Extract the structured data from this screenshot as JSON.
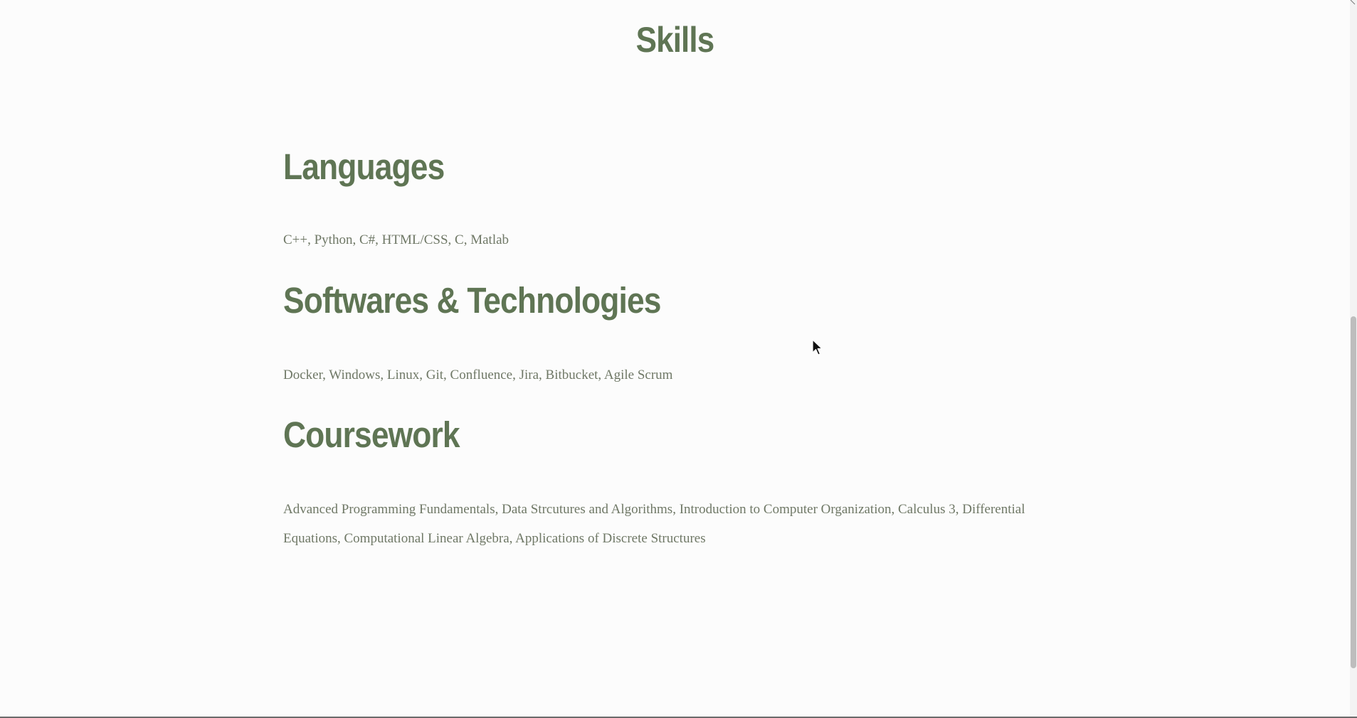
{
  "page": {
    "title": "Skills"
  },
  "sections": [
    {
      "heading": "Languages",
      "text": "C++, Python, C#, HTML/CSS, C, Matlab"
    },
    {
      "heading": "Softwares & Technologies",
      "text": "Docker, Windows, Linux, Git, Confluence, Jira, Bitbucket, Agile Scrum"
    },
    {
      "heading": "Coursework",
      "text": "Advanced Programming Fundamentals, Data Strcutures and Algorithms, Introduction to Computer Organization, Calculus 3, Differential Equations, Computational Linear Algebra, Applications of Discrete Structures"
    }
  ],
  "colors": {
    "heading": "#5f7554",
    "body_text": "#6f7866",
    "background": "#fcfcfc"
  },
  "icons": {
    "cursor": "mouse-pointer-icon"
  }
}
